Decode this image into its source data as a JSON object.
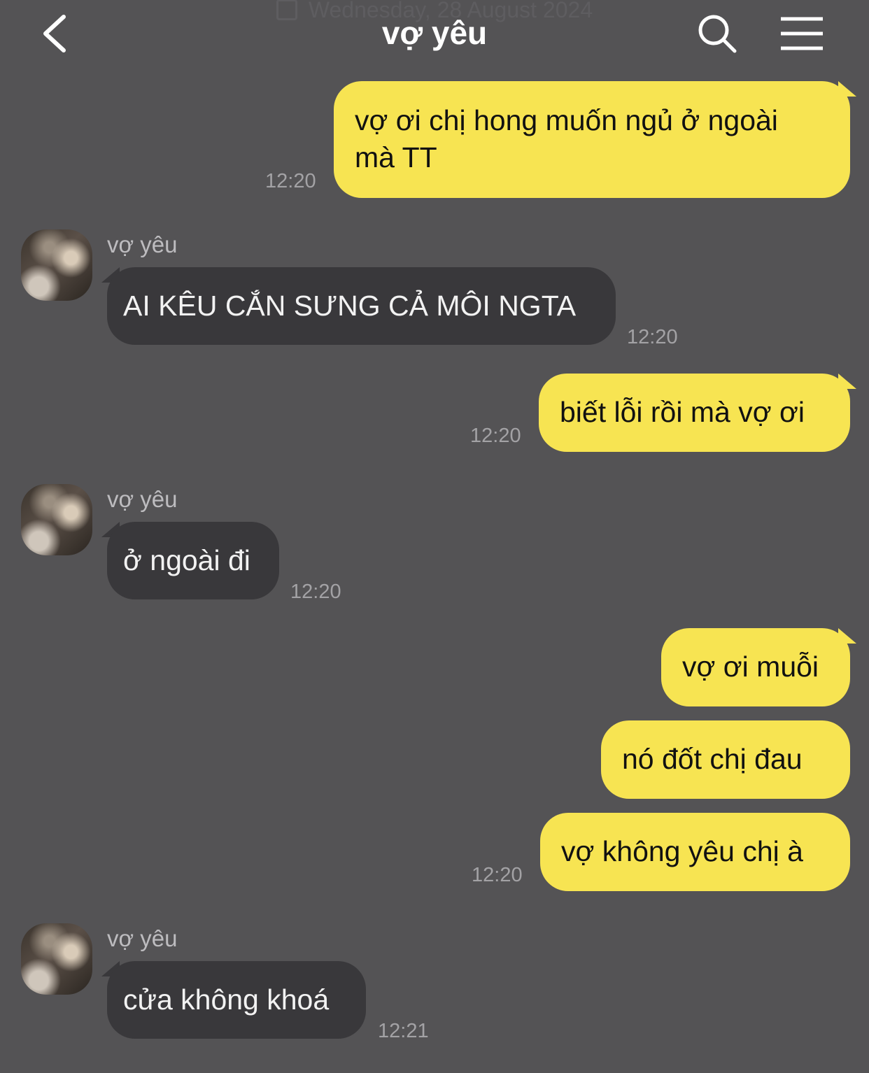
{
  "header": {
    "date": "Wednesday, 28 August 2024",
    "title": "vợ yêu"
  },
  "messages": [
    {
      "side": "out",
      "text_lines": [
        "vợ ơi chị hong muốn ngủ ở ngoài",
        "mà TT"
      ],
      "time": "12:20"
    },
    {
      "side": "in",
      "sender": "vợ yêu",
      "text": "AI KÊU CẮN SƯNG CẢ MÔI NGTA",
      "time": "12:20"
    },
    {
      "side": "out",
      "text": "biết lỗi rồi mà vợ ơi",
      "time": "12:20"
    },
    {
      "side": "in",
      "sender": "vợ yêu",
      "text": "ở ngoài đi",
      "time": "12:20"
    },
    {
      "side": "out",
      "text": "vợ ơi muỗi"
    },
    {
      "side": "out",
      "text": "nó đốt chị đau"
    },
    {
      "side": "out",
      "text": "vợ không yêu chị à",
      "time": "12:20"
    },
    {
      "side": "in",
      "sender": "vợ yêu",
      "text": "cửa không khoá",
      "time": "12:21"
    }
  ],
  "colors": {
    "background": "#545355",
    "outgoing_bubble": "#f7e452",
    "incoming_bubble": "#39383b"
  },
  "icons": [
    "back-arrow-icon",
    "search-icon",
    "menu-icon",
    "calendar-icon"
  ]
}
